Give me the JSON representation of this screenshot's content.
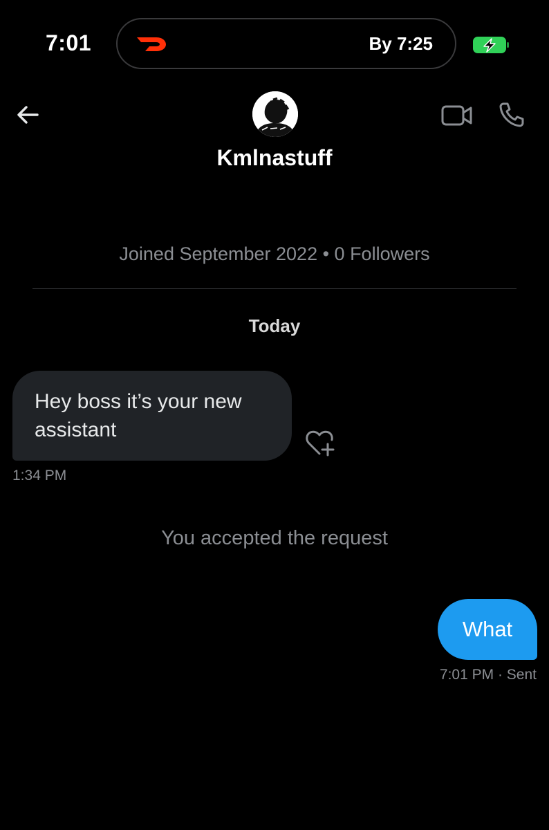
{
  "status_bar": {
    "time": "7:01",
    "live_activity": {
      "app_icon": "doordash-logo-icon",
      "eta": "By 7:25"
    },
    "battery_icon": "battery-charging-icon",
    "battery_color": "#30d158"
  },
  "header": {
    "back_icon": "arrow-left-icon",
    "avatar_icon": "profile-avatar",
    "username": "Kmlnastuff",
    "video_icon": "video-call-icon",
    "call_icon": "phone-call-icon"
  },
  "profile_meta": "Joined September 2022 • 0 Followers",
  "day_separator": "Today",
  "messages": [
    {
      "direction": "incoming",
      "text": "Hey boss it’s your new assistant",
      "time": "1:34 PM",
      "reaction_icon": "heart-add-icon"
    },
    {
      "direction": "outgoing",
      "text": "What",
      "time": "7:01 PM",
      "status": "· Sent"
    }
  ],
  "system_message": "You accepted the request",
  "colors": {
    "background": "#000000",
    "incoming_bubble": "#202327",
    "outgoing_bubble": "#1d9bf0",
    "secondary_text": "#8b8e93"
  }
}
